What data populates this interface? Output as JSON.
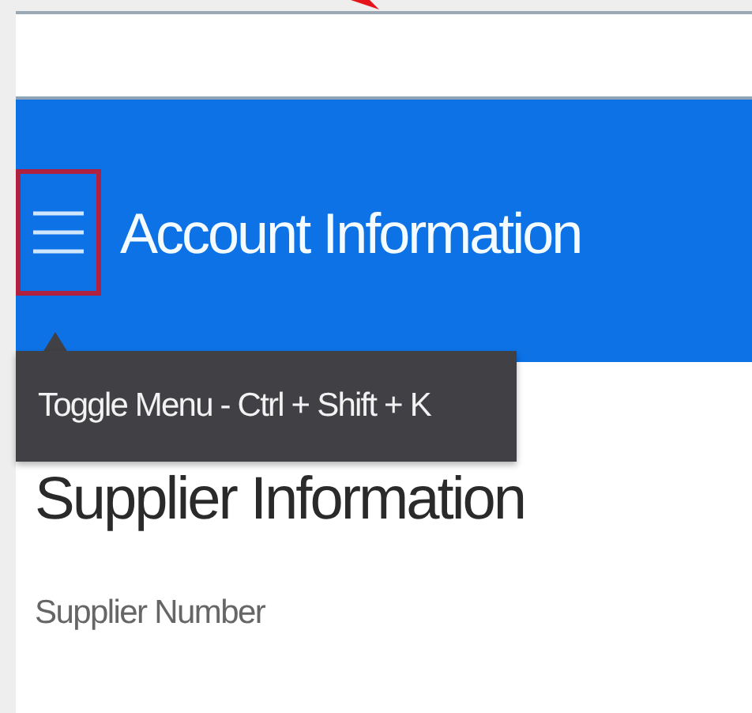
{
  "header": {
    "title": "Account Information"
  },
  "menu_button": {
    "focused": true
  },
  "tooltip": {
    "text": "Toggle Menu - Ctrl + Shift + K"
  },
  "section": {
    "title": "Supplier Information"
  },
  "fields": [
    {
      "label": "Supplier Number"
    }
  ]
}
